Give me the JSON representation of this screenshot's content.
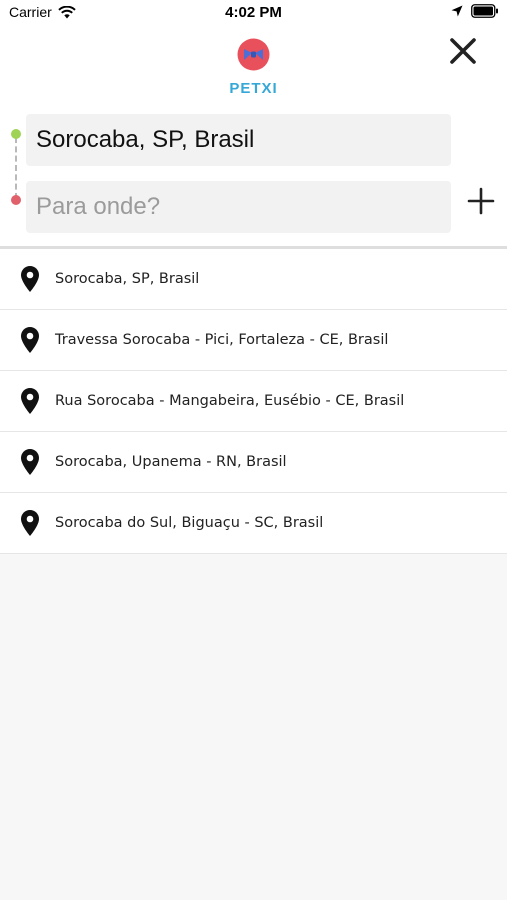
{
  "status_bar": {
    "carrier": "Carrier",
    "time": "4:02 PM"
  },
  "header": {
    "brand": "PETXI",
    "brand_color": "#35a8d8",
    "logo_color": "#e8505b",
    "close_icon": "close-icon"
  },
  "route": {
    "origin_value": "Sorocaba, SP, Brasil",
    "destination_value": "",
    "destination_placeholder": "Para onde?",
    "start_dot_color": "#9fd356",
    "end_dot_color": "#e0606b",
    "add_icon": "plus-icon"
  },
  "suggestions": [
    {
      "label": "Sorocaba, SP, Brasil",
      "icon": "map-pin-icon"
    },
    {
      "label": "Travessa Sorocaba - Pici, Fortaleza - CE, Brasil",
      "icon": "map-pin-icon"
    },
    {
      "label": "Rua Sorocaba - Mangabeira, Eusébio - CE, Brasil",
      "icon": "map-pin-icon"
    },
    {
      "label": "Sorocaba, Upanema - RN, Brasil",
      "icon": "map-pin-icon"
    },
    {
      "label": "Sorocaba do Sul, Biguaçu - SC, Brasil",
      "icon": "map-pin-icon"
    }
  ]
}
